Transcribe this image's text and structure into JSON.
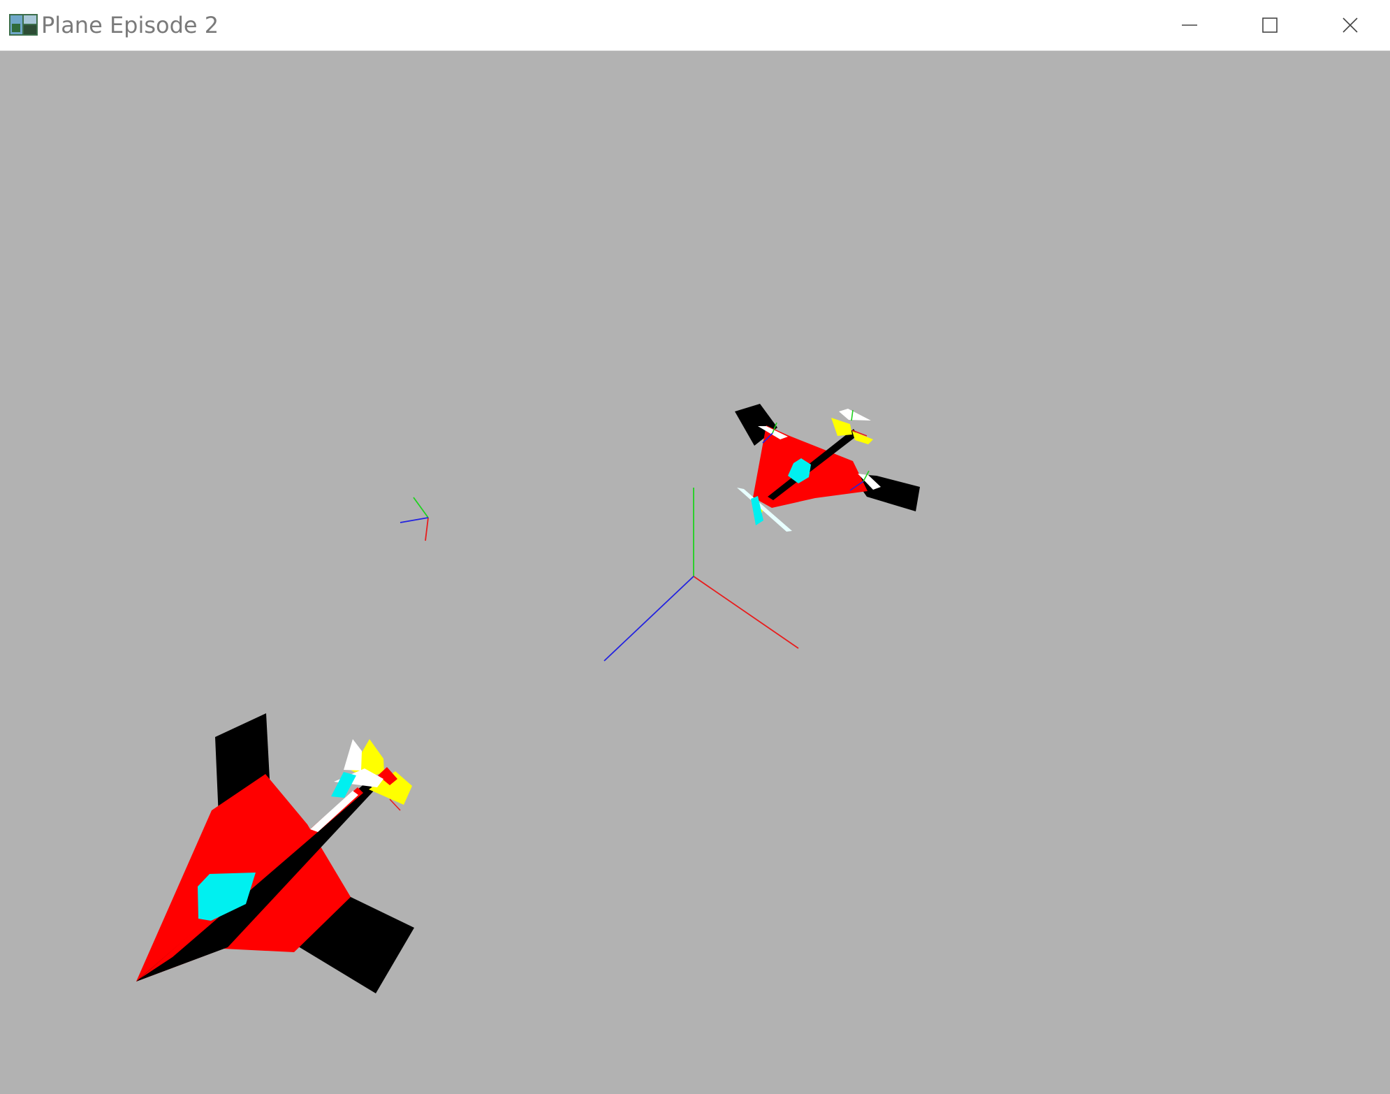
{
  "window": {
    "title": "Plane Episode 2",
    "background": "#b2b2b2",
    "controls": {
      "minimize_icon": "minimize-icon",
      "maximize_icon": "maximize-icon",
      "close_icon": "close-icon"
    }
  },
  "scene": {
    "axis_colors": {
      "x": "#e81c1c",
      "y": "#1ed21e",
      "z": "#2222e0"
    },
    "plane_colors": {
      "wing": "#ff0000",
      "tail": "#000000",
      "canopy": "#00f0f0",
      "engine": "#ffff00",
      "exhaust": "#ffffff"
    }
  }
}
